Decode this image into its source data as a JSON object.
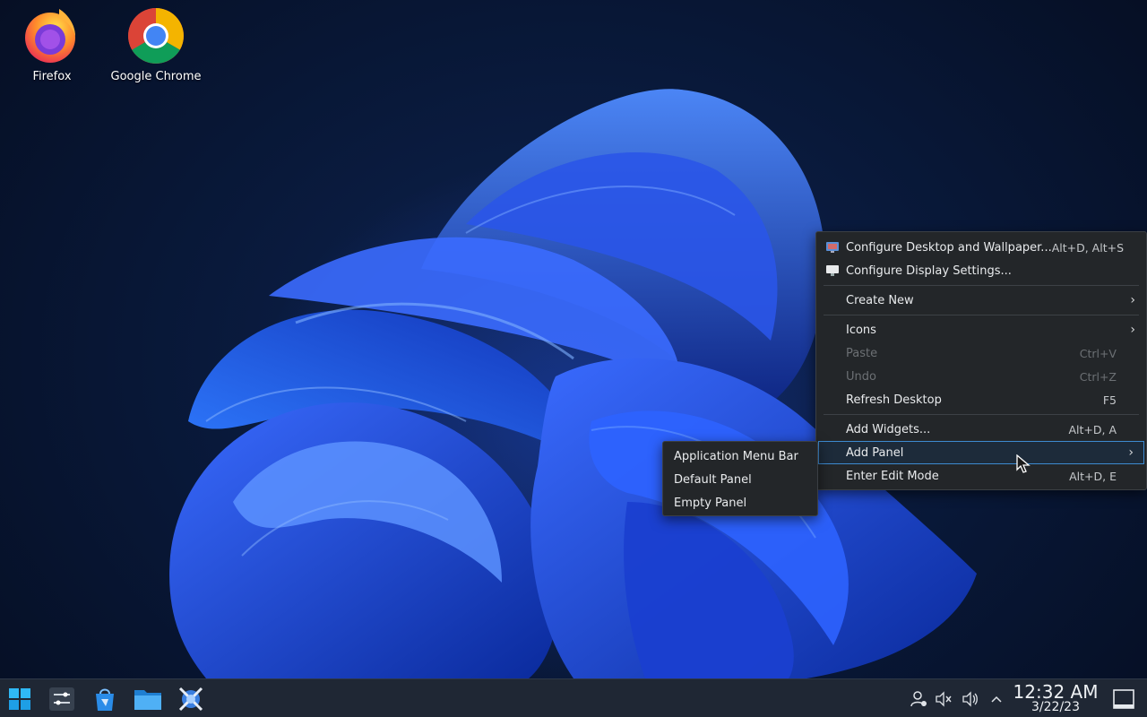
{
  "desktop": {
    "icons": [
      {
        "label": "Firefox",
        "icon": "firefox-icon"
      },
      {
        "label": "Google Chrome",
        "icon": "chrome-icon"
      }
    ]
  },
  "context_menu": {
    "items": [
      {
        "label": "Configure Desktop and Wallpaper...",
        "shortcut": "Alt+D, Alt+S",
        "icon": "configure-desktop-icon"
      },
      {
        "label": "Configure Display Settings...",
        "shortcut": "",
        "icon": "display-icon"
      },
      {
        "label": "Create New",
        "has_submenu": true
      },
      {
        "label": "Icons",
        "has_submenu": true
      },
      {
        "label": "Paste",
        "shortcut": "Ctrl+V",
        "disabled": true
      },
      {
        "label": "Undo",
        "shortcut": "Ctrl+Z",
        "disabled": true
      },
      {
        "label": "Refresh Desktop",
        "shortcut": "F5"
      },
      {
        "label": "Add Widgets...",
        "shortcut": "Alt+D, A"
      },
      {
        "label": "Add Panel",
        "has_submenu": true,
        "active": true
      },
      {
        "label": "Enter Edit Mode",
        "shortcut": "Alt+D, E"
      }
    ],
    "arrow": "›"
  },
  "submenu": {
    "items": [
      {
        "label": "Application Menu Bar"
      },
      {
        "label": "Default Panel"
      },
      {
        "label": "Empty Panel"
      }
    ]
  },
  "taskbar": {
    "launchers": [
      "start-menu-icon",
      "system-settings-icon",
      "discover-store-icon",
      "file-manager-icon",
      "kde-connect-icon"
    ],
    "tray": [
      "user-switch-icon",
      "mute-icon",
      "volume-icon",
      "tray-expand-icon"
    ],
    "clock": {
      "time": "12:32 AM",
      "date": "3/22/23"
    }
  },
  "colors": {
    "accent": "#3d8ad0",
    "menu_bg": "#232629",
    "taskbar_bg": "#1f2734"
  }
}
